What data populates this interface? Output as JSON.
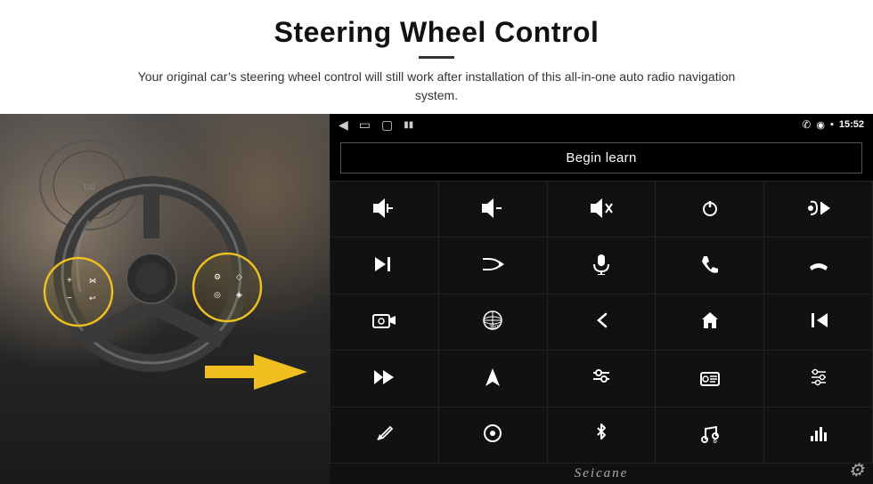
{
  "header": {
    "title": "Steering Wheel Control",
    "subtitle": "Your original car’s steering wheel control will still work after installation of this all-in-one auto radio navigation system."
  },
  "statusBar": {
    "time": "15:52",
    "leftIcons": [
      "back-icon",
      "home-icon",
      "recent-icon",
      "signal-icon"
    ],
    "rightIcons": [
      "phone-icon",
      "location-icon",
      "wifi-icon",
      "time-label"
    ]
  },
  "beginLearn": {
    "label": "Begin learn"
  },
  "iconGrid": {
    "rows": 5,
    "cols": 5,
    "cells": [
      {
        "id": "vol-up",
        "icon": "🔊",
        "label": "Volume Up",
        "extra": "+"
      },
      {
        "id": "vol-down",
        "icon": "🔊",
        "label": "Volume Down",
        "extra": "-"
      },
      {
        "id": "mute",
        "icon": "🔇",
        "label": "Mute",
        "extra": ""
      },
      {
        "id": "power",
        "icon": "⏻",
        "label": "Power",
        "extra": ""
      },
      {
        "id": "phone-prev",
        "icon": "📞",
        "label": "Phone/Prev",
        "extra": ""
      },
      {
        "id": "next-track",
        "icon": "⏭",
        "label": "Next Track",
        "extra": ""
      },
      {
        "id": "shuffle",
        "icon": "🔀",
        "label": "Shuffle",
        "extra": ""
      },
      {
        "id": "mic",
        "icon": "🎤",
        "label": "Microphone",
        "extra": ""
      },
      {
        "id": "phone-call",
        "icon": "📞",
        "label": "Phone Call",
        "extra": ""
      },
      {
        "id": "phone-end2",
        "icon": "📵",
        "label": "End Call",
        "extra": ""
      },
      {
        "id": "camera",
        "icon": "📷",
        "label": "Camera",
        "extra": ""
      },
      {
        "id": "view360",
        "icon": "👁",
        "label": "360 View",
        "extra": "°"
      },
      {
        "id": "back",
        "icon": "↩",
        "label": "Back",
        "extra": ""
      },
      {
        "id": "home",
        "icon": "⌂",
        "label": "Home",
        "extra": ""
      },
      {
        "id": "skip-back",
        "icon": "⏮",
        "label": "Skip Back",
        "extra": ""
      },
      {
        "id": "fast-fwd",
        "icon": "⏩",
        "label": "Fast Forward",
        "extra": ""
      },
      {
        "id": "nav",
        "icon": "▲",
        "label": "Navigation",
        "extra": ""
      },
      {
        "id": "eq",
        "icon": "≡",
        "label": "Equalizer",
        "extra": ""
      },
      {
        "id": "radio",
        "icon": "📻",
        "label": "Radio",
        "extra": ""
      },
      {
        "id": "settings-grid",
        "icon": "⊞",
        "label": "Settings Grid",
        "extra": ""
      },
      {
        "id": "pen",
        "icon": "✏",
        "label": "Pen/Edit",
        "extra": ""
      },
      {
        "id": "circle",
        "icon": "◎",
        "label": "Circle/360",
        "extra": ""
      },
      {
        "id": "bluetooth",
        "icon": "⚡",
        "label": "Bluetooth",
        "extra": ""
      },
      {
        "id": "music",
        "icon": "♪",
        "label": "Music",
        "extra": ""
      },
      {
        "id": "equalizer",
        "icon": "📊",
        "label": "Equalizer Bars",
        "extra": ""
      }
    ]
  },
  "footer": {
    "watermark": "Seicane"
  },
  "colors": {
    "bg": "#ffffff",
    "panelBg": "#000000",
    "gridBg": "#111111",
    "gridBorder": "#222222",
    "accent": "#f0c020",
    "textDark": "#111111",
    "textLight": "#ffffff"
  }
}
